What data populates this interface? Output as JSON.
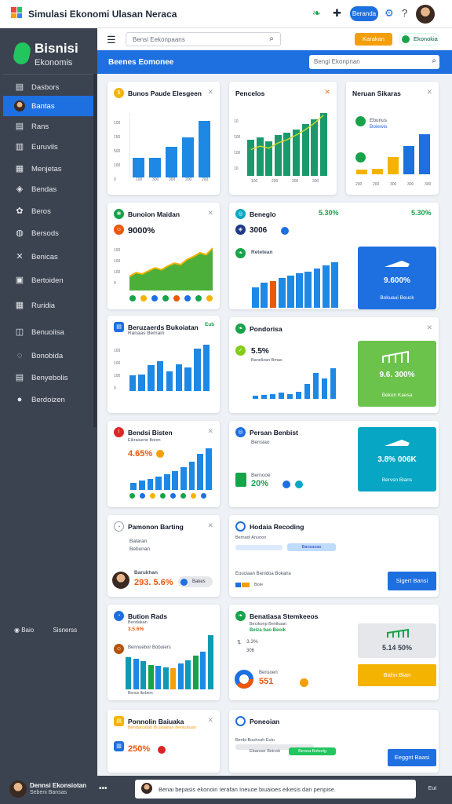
{
  "app": {
    "title": "Simulasi Ekonomi Ulasan Neraca",
    "pill": "Beranda"
  },
  "sidebar": {
    "brand_name": "Bisnisi",
    "brand_sub": "Ekonomis",
    "items": [
      {
        "label": "Dasbors",
        "icon": "▤"
      },
      {
        "label": "Bantas",
        "icon": "●"
      },
      {
        "label": "Rans",
        "icon": "▤"
      },
      {
        "label": "Euruvils",
        "icon": "▥"
      },
      {
        "label": "Menjetas",
        "icon": "▦"
      },
      {
        "label": "Bendas",
        "icon": "◈"
      },
      {
        "label": "Beros",
        "icon": "✿"
      },
      {
        "label": "Bersods",
        "icon": "◍"
      },
      {
        "label": "Benicas",
        "icon": "✕"
      },
      {
        "label": "Bertoiden",
        "icon": "▣"
      },
      {
        "label": "Ruridia",
        "icon": "▦"
      },
      {
        "label": "Benuoiisa",
        "icon": "◫"
      },
      {
        "label": "Bonobida",
        "icon": "◌"
      },
      {
        "label": "Benyebolis",
        "icon": "▤"
      },
      {
        "label": "Berdoizen",
        "icon": "●"
      }
    ],
    "footer_left": "Baio",
    "footer_right": "Sisnerss"
  },
  "topbar": {
    "search_placeholder": "Bensi Eekonpaans",
    "btn_orange": "Karakan",
    "btn_green": "Ekonokia"
  },
  "header": {
    "title": "Beenes Eomonee",
    "search_placeholder": "Bengi Ekonpnan"
  },
  "colors": {
    "primary": "#1e6fe0",
    "green": "#16a34a",
    "orange": "#f59e0b",
    "teal": "#06a6c4",
    "sidebar": "#3b4350"
  },
  "cards": {
    "c1": {
      "title": "Bunos Paude Elesgeen",
      "ticks": [
        "100",
        "150",
        "500",
        "100",
        "0"
      ],
      "xlabels": [
        "100",
        "300",
        "300",
        "200",
        "200"
      ]
    },
    "c2": {
      "title": "Pencelos",
      "ticks": [
        "10",
        "100",
        "100",
        "10"
      ],
      "xlabels": [
        "100",
        "200",
        "300",
        "300"
      ]
    },
    "c3": {
      "title": "Neruan Sikaras",
      "legend1": "Ebunus",
      "legend2": "Boiewis",
      "xlabels": [
        "200",
        "200",
        "300",
        "300",
        "300"
      ]
    },
    "c4": {
      "title": "Bunoion Maidan",
      "value": "9000%",
      "ticks": [
        "100",
        "100",
        "100",
        "0"
      ]
    },
    "c5": {
      "title": "Beneglo",
      "value": "3006",
      "pct1": "5.30%",
      "pct2": "5.30%",
      "sub": "Retetean"
    },
    "tile1": {
      "value": "9.600%",
      "label": "Bokuaui Beuck"
    },
    "c6": {
      "title": "Beruzaerds Bukoiatan",
      "badge": "Eub",
      "sub": "Ranaas Bemain",
      "ticks": [
        "100",
        "100",
        "100",
        "0"
      ]
    },
    "c7": {
      "title": "Pondorisa",
      "value": "5.5%",
      "sub": "Banelizan Bmas"
    },
    "tile2": {
      "value": "9.6. 300%",
      "label": "Bekon Kaesa"
    },
    "c8": {
      "title": "Bendsi Bisten",
      "value": "4.65%",
      "sub": "Eikraiuene Boion"
    },
    "c9": {
      "title": "Persan Benbist",
      "sub": "Bensiao",
      "sub2": "Bernooe",
      "value": "20%"
    },
    "tile3": {
      "value": "3.8% 006K",
      "label": "Bervsn Bians"
    },
    "c10": {
      "title": "Pamonon Barting",
      "sub1": "Balaran",
      "sub2": "Bebunan",
      "person": "Barukhan",
      "value": "293. 5.6%",
      "tag": "Bakes"
    },
    "c11": {
      "title": "Hodaia Recoding",
      "sub": "Bernadi Anuooo",
      "tag": "Bansaoas",
      "label": "Eouciaan Benidoa Bokaira",
      "small": "Boie",
      "button": "Sigert Bansi"
    },
    "c12": {
      "title": "Bution Rads",
      "sub": "Bendakan",
      "value": "3.5.6%",
      "person": "Bennuebor Bobuiers",
      "legend": "Benus ikebem"
    },
    "c13": {
      "title": "Benatiasa Stemkeeos",
      "sub": "Becikonp Benikaan",
      "badge": "Beiza bao Beoik",
      "val1": "3.3%",
      "sub2": "Bensoen",
      "val2": "551",
      "val3": "306",
      "tile_value": "5.14 50%",
      "btn": "Bahn Bian"
    },
    "c14": {
      "title": "Ponnolin Baiuaka",
      "sub": "Bendarcatah Bundakian Bentuhuan",
      "value": "250%"
    },
    "c15": {
      "title": "Poneoian",
      "sub": "Benbi Buuhosh Eulu",
      "sub2": "Ebanoer Boinok",
      "tag": "Beooa Boleolg",
      "button": "Eeggnt Baasi"
    }
  },
  "chart_data": [
    {
      "type": "bar",
      "title": "Bunos Paude Elesgeen",
      "categories": [
        "100",
        "300",
        "300",
        "200",
        "200"
      ],
      "values": [
        30,
        30,
        48,
        62,
        88
      ],
      "ylim": [
        0,
        100
      ]
    },
    {
      "type": "bar",
      "title": "Pencelos",
      "categories": [
        "100",
        "200",
        "300",
        "300"
      ],
      "values": [
        55,
        58,
        52,
        62,
        65,
        70,
        78,
        86,
        95
      ],
      "series": [
        {
          "name": "trend",
          "values": [
            40,
            45,
            42,
            50,
            55,
            62,
            70,
            80,
            92
          ]
        }
      ],
      "ylim": [
        0,
        100
      ]
    },
    {
      "type": "bar",
      "title": "Neruan Sikaras",
      "categories": [
        "200",
        "200",
        "300",
        "300",
        "300"
      ],
      "values": [
        10,
        12,
        35,
        58,
        82
      ]
    },
    {
      "type": "area",
      "title": "Bunoion Maidan",
      "values": [
        30,
        38,
        35,
        42,
        48,
        44,
        52,
        58,
        55,
        66,
        72,
        80,
        76,
        90
      ]
    },
    {
      "type": "bar",
      "title": "Beneglo",
      "values": [
        40,
        48,
        52,
        58,
        62,
        66,
        70,
        76,
        82,
        88
      ]
    },
    {
      "type": "bar",
      "title": "Beruzaerds Bukoiatan",
      "values": [
        30,
        32,
        50,
        58,
        38,
        52,
        45,
        82,
        90
      ]
    },
    {
      "type": "bar",
      "title": "Pondorisa",
      "values": [
        8,
        10,
        12,
        14,
        12,
        16,
        36,
        62,
        48,
        72
      ]
    },
    {
      "type": "bar",
      "title": "Bendsi Bisten",
      "values": [
        15,
        20,
        24,
        30,
        34,
        42,
        50,
        62,
        80,
        92
      ]
    },
    {
      "type": "bar",
      "title": "Bution Rads",
      "values": [
        52,
        50,
        46,
        40,
        38,
        36,
        34,
        42,
        48,
        55,
        62,
        88
      ]
    }
  ]
}
